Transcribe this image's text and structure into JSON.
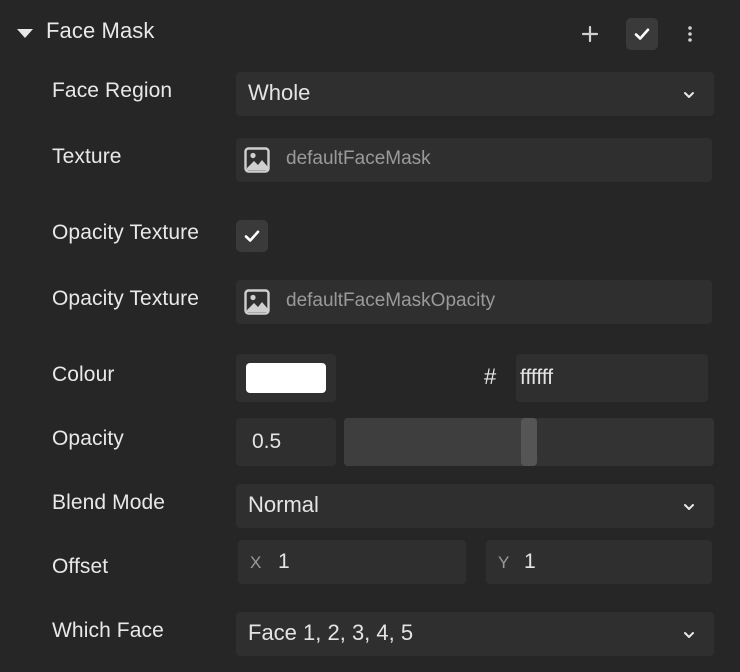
{
  "header": {
    "title": "Face Mask",
    "icons": {
      "collapse": "caret-down-icon",
      "add": "plus-icon",
      "enabled": "check-icon",
      "more": "more-vertical-icon"
    }
  },
  "rows": {
    "face_region": {
      "label": "Face Region",
      "value": "Whole"
    },
    "texture": {
      "label": "Texture",
      "value": "defaultFaceMask"
    },
    "opacity_texture_toggle": {
      "label": "Opacity Texture",
      "checked": true
    },
    "opacity_texture": {
      "label": "Opacity Texture",
      "value": "defaultFaceMaskOpacity"
    },
    "colour": {
      "label": "Colour",
      "swatch": "#ffffff",
      "hash": "#",
      "hex": "ffffff"
    },
    "opacity": {
      "label": "Opacity",
      "value": "0.5",
      "fraction": 0.5
    },
    "blend_mode": {
      "label": "Blend Mode",
      "value": "Normal"
    },
    "offset": {
      "label": "Offset",
      "x_label": "X",
      "x_value": "1",
      "y_label": "Y",
      "y_value": "1"
    },
    "which_face": {
      "label": "Which Face",
      "value": "Face 1, 2, 3, 4, 5"
    }
  },
  "colors": {
    "background": "#262626",
    "field": "#2f2f2f",
    "button": "#3a3a3a"
  }
}
